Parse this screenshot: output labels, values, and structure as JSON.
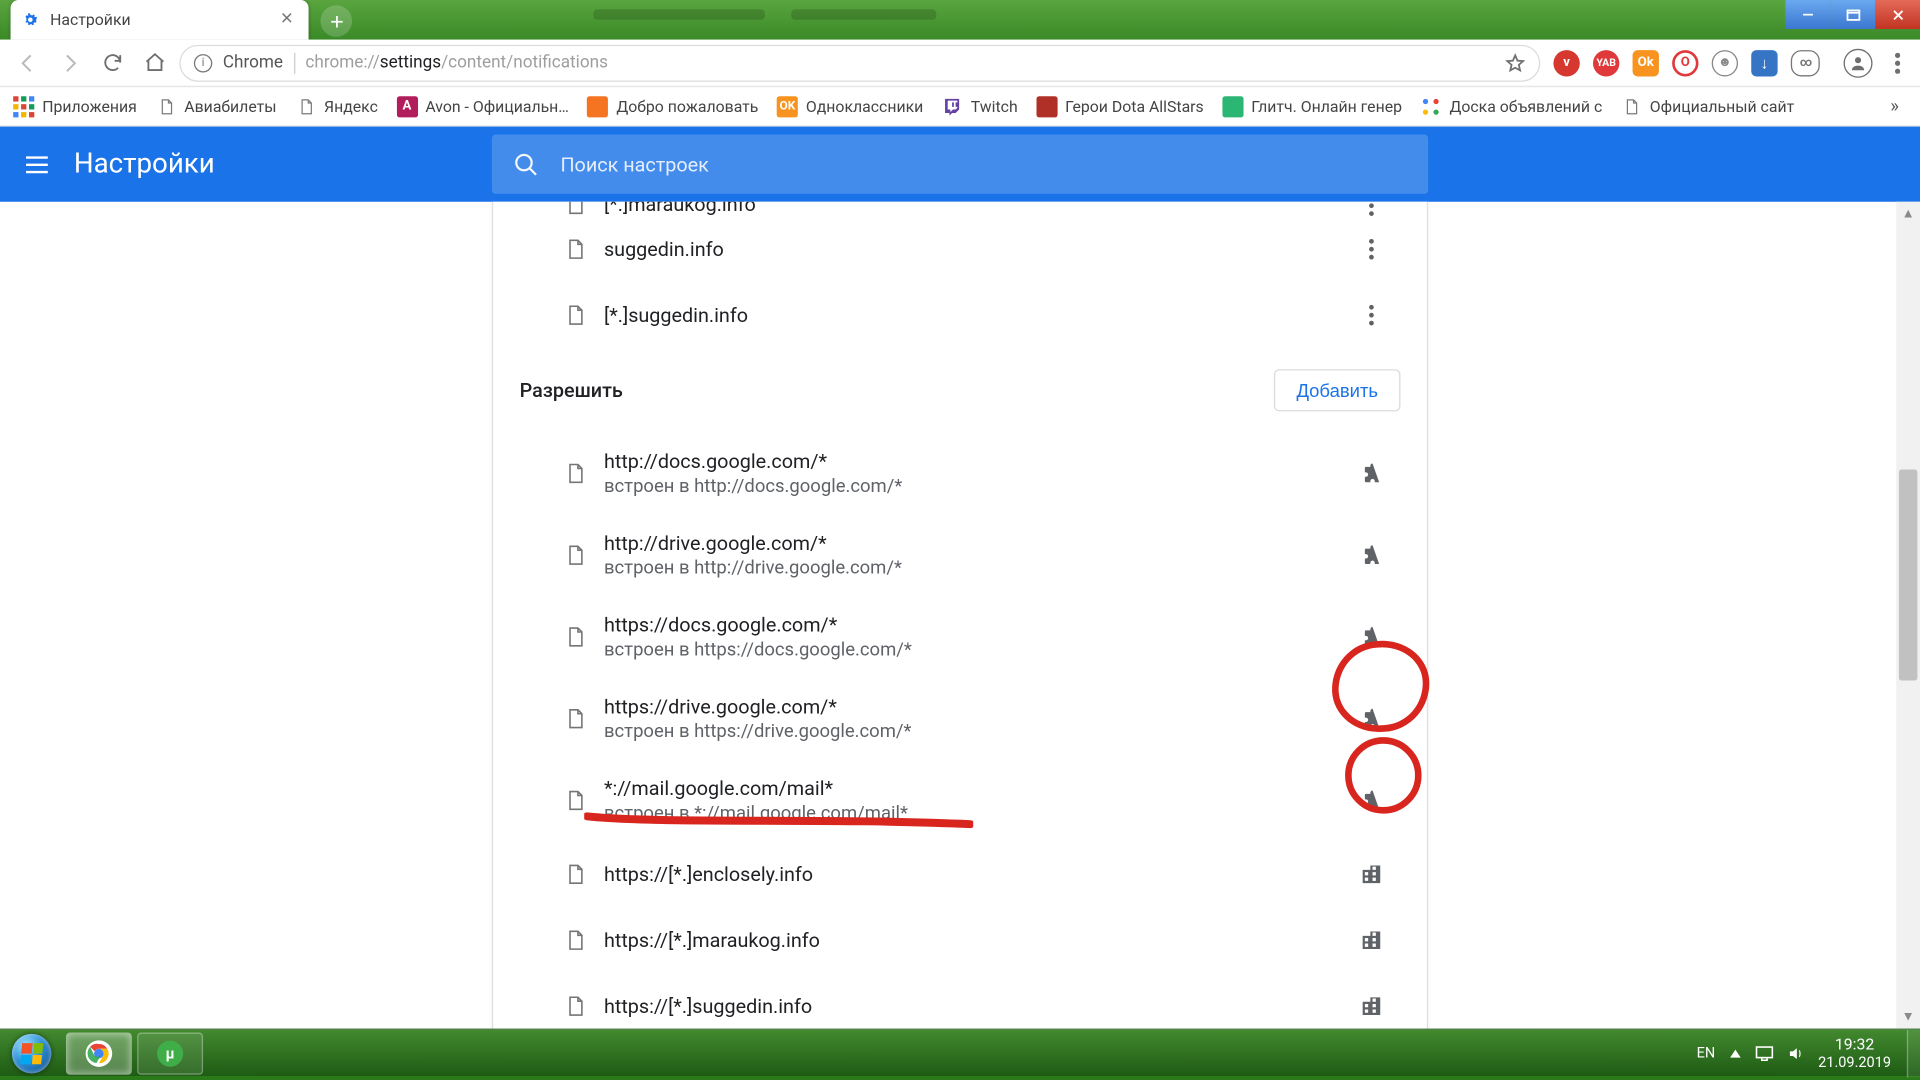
{
  "tab": {
    "title": "Настройки"
  },
  "omnibox": {
    "secure_label": "Chrome",
    "url_prefix": "chrome://",
    "url_bold": "settings",
    "url_suffix": "/content/notifications"
  },
  "bookmarks": {
    "apps": "Приложения",
    "items": [
      {
        "label": "Авиабилеты"
      },
      {
        "label": "Яндекс"
      },
      {
        "label": "Avon - Официальн…",
        "icon": "avon"
      },
      {
        "label": "Добро пожаловать",
        "icon": "orange"
      },
      {
        "label": "Одноклассники",
        "icon": "ok"
      },
      {
        "label": "Twitch",
        "icon": "twitch"
      },
      {
        "label": "Герои Dota AllStars",
        "icon": "dota"
      },
      {
        "label": "Глитч. Онлайн генер",
        "icon": "green"
      },
      {
        "label": "Доска объявлений с",
        "icon": "dots"
      },
      {
        "label": "Официальный сайт"
      }
    ]
  },
  "settings": {
    "title": "Настройки",
    "search_placeholder": "Поиск настроек",
    "block_section": {
      "items": [
        {
          "site": "[*.]maraukog.info"
        },
        {
          "site": "suggedin.info"
        },
        {
          "site": "[*.]suggedin.info"
        }
      ]
    },
    "allow_section": {
      "label": "Разрешить",
      "add": "Добавить",
      "items": [
        {
          "site": "http://docs.google.com/*",
          "embed": "встроен в http://docs.google.com/*",
          "right": "puzzle"
        },
        {
          "site": "http://drive.google.com/*",
          "embed": "встроен в http://drive.google.com/*",
          "right": "puzzle"
        },
        {
          "site": "https://docs.google.com/*",
          "embed": "встроен в https://docs.google.com/*",
          "right": "puzzle"
        },
        {
          "site": "https://drive.google.com/*",
          "embed": "встроен в https://drive.google.com/*",
          "right": "puzzle"
        },
        {
          "site": "*://mail.google.com/mail*",
          "embed": "встроен в *://mail.google.com/mail*",
          "right": "puzzle"
        },
        {
          "site": "https://[*.]enclosely.info",
          "right": "building"
        },
        {
          "site": "https://[*.]maraukog.info",
          "right": "building"
        },
        {
          "site": "https://[*.]suggedin.info",
          "right": "building"
        }
      ]
    }
  },
  "tray": {
    "lang": "EN",
    "time": "19:32",
    "date": "21.09.2019"
  }
}
